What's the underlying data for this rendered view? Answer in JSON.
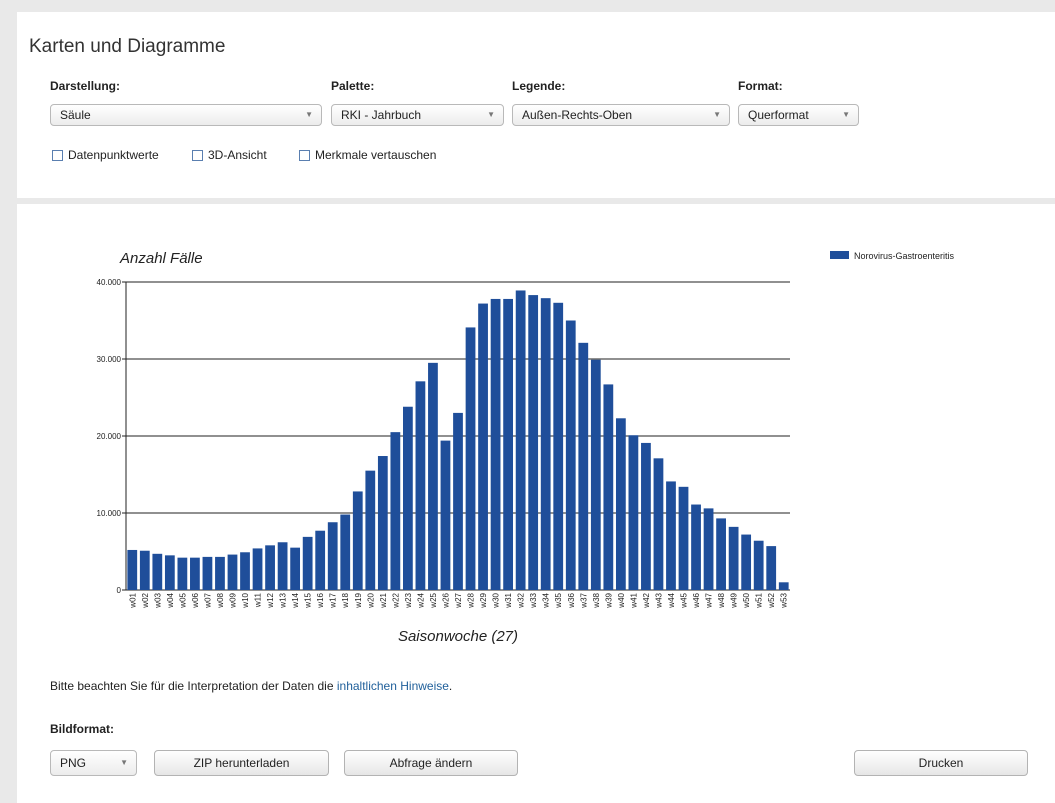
{
  "header": {
    "title": "Karten und Diagramme"
  },
  "controls": {
    "darstellung": {
      "label": "Darstellung:",
      "value": "Säule"
    },
    "palette": {
      "label": "Palette:",
      "value": "RKI - Jahrbuch"
    },
    "legende": {
      "label": "Legende:",
      "value": "Außen-Rechts-Oben"
    },
    "format": {
      "label": "Format:",
      "value": "Querformat"
    }
  },
  "options": {
    "datenpunktwerte": "Datenpunktwerte",
    "ansicht_3d": "3D-Ansicht",
    "merkmale": "Merkmale vertauschen"
  },
  "chart_data": {
    "type": "bar",
    "ylabel": "Anzahl Fälle",
    "xlabel": "Saisonwoche (27)",
    "ylim": [
      0,
      40000
    ],
    "yticks": [
      "0",
      "10.000",
      "20.000",
      "30.000",
      "40.000"
    ],
    "grid": true,
    "legend_position": "top-right",
    "categories": [
      "w01",
      "w02",
      "w03",
      "w04",
      "w05",
      "w06",
      "w07",
      "w08",
      "w09",
      "w10",
      "w11",
      "w12",
      "w13",
      "w14",
      "w15",
      "w16",
      "w17",
      "w18",
      "w19",
      "w20",
      "w21",
      "w22",
      "w23",
      "w24",
      "w25",
      "w26",
      "w27",
      "w28",
      "w29",
      "w30",
      "w31",
      "w32",
      "w33",
      "w34",
      "w35",
      "w36",
      "w37",
      "w38",
      "w39",
      "w40",
      "w41",
      "w42",
      "w43",
      "w44",
      "w45",
      "w46",
      "w47",
      "w48",
      "w49",
      "w50",
      "w51",
      "w52",
      "w53"
    ],
    "series": [
      {
        "name": "Norovirus-Gastroenteritis",
        "color": "#1f4e9a",
        "values": [
          5200,
          5100,
          4700,
          4500,
          4200,
          4200,
          4300,
          4300,
          4600,
          4900,
          5400,
          5800,
          6200,
          5500,
          6900,
          7700,
          8800,
          9800,
          12800,
          15500,
          17400,
          20500,
          23800,
          27100,
          29500,
          19400,
          23000,
          34100,
          37200,
          37800,
          37800,
          38900,
          38300,
          37900,
          37300,
          35000,
          32100,
          29900,
          26700,
          22300,
          20100,
          19100,
          17100,
          14100,
          13400,
          11100,
          10600,
          9300,
          8200,
          7200,
          6400,
          5700,
          1000
        ]
      }
    ]
  },
  "note": {
    "text": "Bitte beachten Sie für die Interpretation der Daten die ",
    "link": "inhaltlichen Hinweise",
    "suffix": "."
  },
  "bildformat": {
    "label": "Bildformat:",
    "value": "PNG",
    "zip_button": "ZIP herunterladen",
    "change_button": "Abfrage ändern",
    "print_button": "Drucken"
  }
}
